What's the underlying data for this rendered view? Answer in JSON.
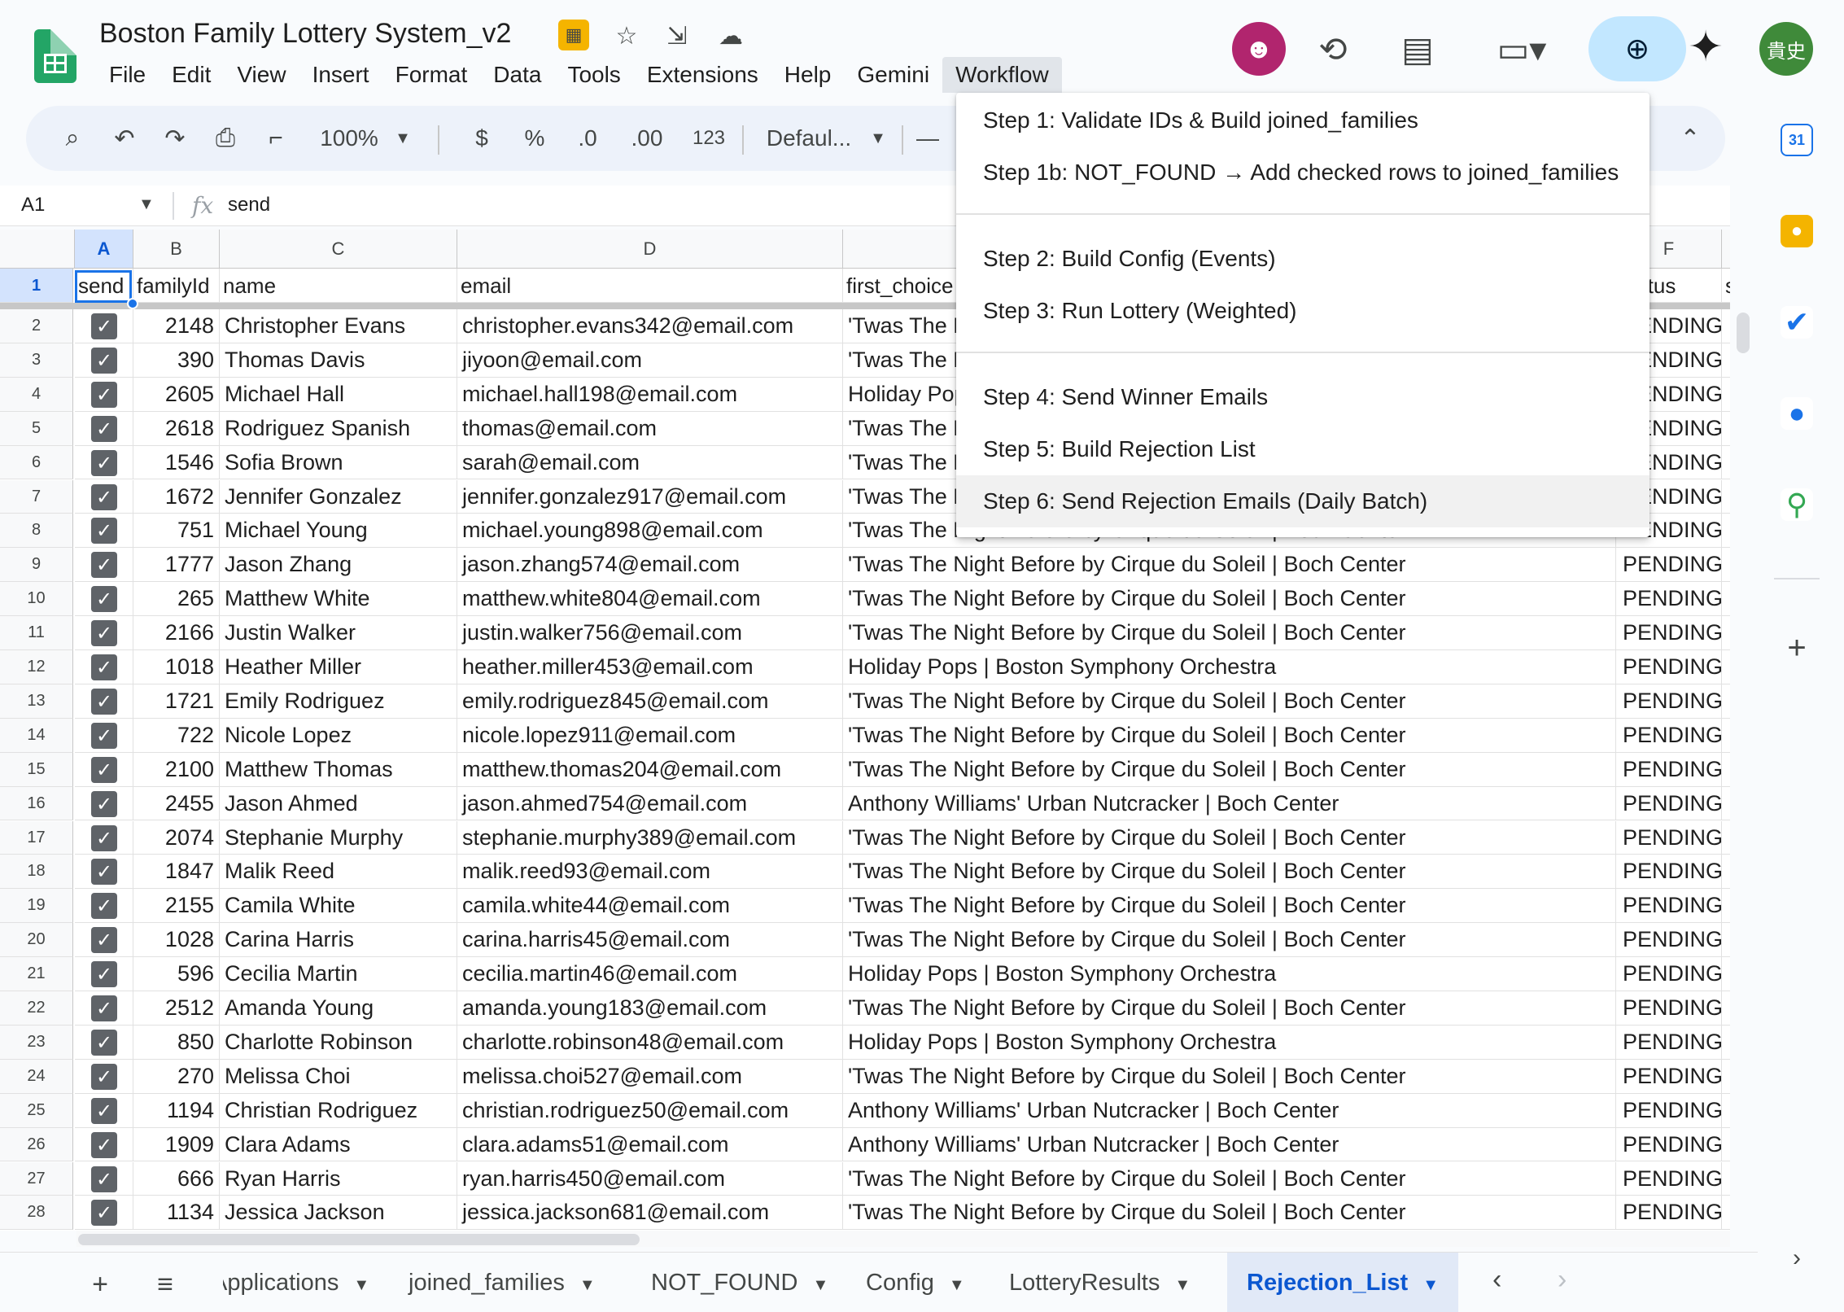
{
  "app": {
    "doc_title": "Boston Family Lottery System_v2",
    "menus": [
      "File",
      "Edit",
      "View",
      "Insert",
      "Format",
      "Data",
      "Tools",
      "Extensions",
      "Help",
      "Gemini",
      "Workflow"
    ],
    "active_menu": "Workflow",
    "user_initials": "貴史"
  },
  "toolbar": {
    "zoom": "100%",
    "currency": "$",
    "percent": "%",
    "decrease_decimals": ".0",
    "increase_decimals": ".00",
    "number_format": "123",
    "font": "Defaul...",
    "font_size_minus": "—"
  },
  "formula_bar": {
    "cell_ref": "A1",
    "fx": "fx",
    "value": "send"
  },
  "workflow_menu": {
    "groups": [
      [
        "Step 1: Validate IDs & Build joined_families",
        "Step 1b: NOT_FOUND → Add checked rows to joined_families"
      ],
      [
        "Step 2: Build Config (Events)",
        "Step 3: Run Lottery (Weighted)"
      ],
      [
        "Step 4: Send Winner Emails",
        "Step 5: Build Rejection List",
        "Step 6: Send Rejection Emails (Daily Batch)"
      ]
    ],
    "hovered": "Step 6: Send Rejection Emails (Daily Batch)"
  },
  "grid": {
    "column_letters": [
      "A",
      "B",
      "C",
      "D",
      "",
      "F",
      ""
    ],
    "header_row_number": "1",
    "headers": {
      "send": "send",
      "familyId": "familyId",
      "name": "name",
      "email": "email",
      "first_choice": "first_choice",
      "status": "status",
      "extra": "s"
    },
    "rows": [
      {
        "n": "2",
        "checked": true,
        "familyId": "2148",
        "name": "Christopher Evans",
        "email": "christopher.evans342@email.com",
        "first_choice": "'Twas The Night Before by Cirque du Soleil | Boch Center",
        "status": "PENDING"
      },
      {
        "n": "3",
        "checked": true,
        "familyId": "390",
        "name": "Thomas Davis",
        "email": "jiyoon@email.com",
        "first_choice": "'Twas The Night Before by Cirque du Soleil | Boch Center",
        "status": "PENDING"
      },
      {
        "n": "4",
        "checked": true,
        "familyId": "2605",
        "name": "Michael Hall",
        "email": "michael.hall198@email.com",
        "first_choice": "Holiday Pops | Boston Symphony Orchestra",
        "status": "PENDING"
      },
      {
        "n": "5",
        "checked": true,
        "familyId": "2618",
        "name": "Rodriguez Spanish",
        "email": "thomas@email.com",
        "first_choice": "'Twas The Night Before by Cirque du Soleil | Boch Center",
        "status": "PENDING"
      },
      {
        "n": "6",
        "checked": true,
        "familyId": "1546",
        "name": "Sofia Brown",
        "email": "sarah@email.com",
        "first_choice": "'Twas The Night Before by Cirque du Soleil | Boch Center",
        "status": "PENDING"
      },
      {
        "n": "7",
        "checked": true,
        "familyId": "1672",
        "name": "Jennifer Gonzalez",
        "email": "jennifer.gonzalez917@email.com",
        "first_choice": "'Twas The Night Before by Cirque du Soleil | Boch Center",
        "status": "PENDING"
      },
      {
        "n": "8",
        "checked": true,
        "familyId": "751",
        "name": "Michael Young",
        "email": "michael.young898@email.com",
        "first_choice": "'Twas The Night Before by Cirque du Soleil | Boch Center",
        "status": "PENDING"
      },
      {
        "n": "9",
        "checked": true,
        "familyId": "1777",
        "name": "Jason Zhang",
        "email": "jason.zhang574@email.com",
        "first_choice": "'Twas The Night Before by Cirque du Soleil | Boch Center",
        "status": "PENDING"
      },
      {
        "n": "10",
        "checked": true,
        "familyId": "265",
        "name": "Matthew White",
        "email": "matthew.white804@email.com",
        "first_choice": "'Twas The Night Before by Cirque du Soleil | Boch Center",
        "status": "PENDING"
      },
      {
        "n": "11",
        "checked": true,
        "familyId": "2166",
        "name": "Justin Walker",
        "email": "justin.walker756@email.com",
        "first_choice": "'Twas The Night Before by Cirque du Soleil | Boch Center",
        "status": "PENDING"
      },
      {
        "n": "12",
        "checked": true,
        "familyId": "1018",
        "name": "Heather Miller",
        "email": "heather.miller453@email.com",
        "first_choice": "Holiday Pops | Boston Symphony Orchestra",
        "status": "PENDING"
      },
      {
        "n": "13",
        "checked": true,
        "familyId": "1721",
        "name": "Emily Rodriguez",
        "email": "emily.rodriguez845@email.com",
        "first_choice": "'Twas The Night Before by Cirque du Soleil | Boch Center",
        "status": "PENDING"
      },
      {
        "n": "14",
        "checked": true,
        "familyId": "722",
        "name": "Nicole Lopez",
        "email": "nicole.lopez911@email.com",
        "first_choice": "'Twas The Night Before by Cirque du Soleil | Boch Center",
        "status": "PENDING"
      },
      {
        "n": "15",
        "checked": true,
        "familyId": "2100",
        "name": "Matthew Thomas",
        "email": "matthew.thomas204@email.com",
        "first_choice": "'Twas The Night Before by Cirque du Soleil | Boch Center",
        "status": "PENDING"
      },
      {
        "n": "16",
        "checked": true,
        "familyId": "2455",
        "name": "Jason Ahmed",
        "email": "jason.ahmed754@email.com",
        "first_choice": "Anthony Williams' Urban Nutcracker | Boch Center",
        "status": "PENDING"
      },
      {
        "n": "17",
        "checked": true,
        "familyId": "2074",
        "name": "Stephanie Murphy",
        "email": "stephanie.murphy389@email.com",
        "first_choice": "'Twas The Night Before by Cirque du Soleil | Boch Center",
        "status": "PENDING"
      },
      {
        "n": "18",
        "checked": true,
        "familyId": "1847",
        "name": "Malik Reed",
        "email": "malik.reed93@email.com",
        "first_choice": "'Twas The Night Before by Cirque du Soleil | Boch Center",
        "status": "PENDING"
      },
      {
        "n": "19",
        "checked": true,
        "familyId": "2155",
        "name": "Camila White",
        "email": "camila.white44@email.com",
        "first_choice": "'Twas The Night Before by Cirque du Soleil | Boch Center",
        "status": "PENDING"
      },
      {
        "n": "20",
        "checked": true,
        "familyId": "1028",
        "name": "Carina Harris",
        "email": "carina.harris45@email.com",
        "first_choice": "'Twas The Night Before by Cirque du Soleil | Boch Center",
        "status": "PENDING"
      },
      {
        "n": "21",
        "checked": true,
        "familyId": "596",
        "name": "Cecilia Martin",
        "email": "cecilia.martin46@email.com",
        "first_choice": "Holiday Pops | Boston Symphony Orchestra",
        "status": "PENDING"
      },
      {
        "n": "22",
        "checked": true,
        "familyId": "2512",
        "name": "Amanda Young",
        "email": "amanda.young183@email.com",
        "first_choice": "'Twas The Night Before by Cirque du Soleil | Boch Center",
        "status": "PENDING"
      },
      {
        "n": "23",
        "checked": true,
        "familyId": "850",
        "name": "Charlotte Robinson",
        "email": "charlotte.robinson48@email.com",
        "first_choice": "Holiday Pops | Boston Symphony Orchestra",
        "status": "PENDING"
      },
      {
        "n": "24",
        "checked": true,
        "familyId": "270",
        "name": "Melissa Choi",
        "email": "melissa.choi527@email.com",
        "first_choice": "'Twas The Night Before by Cirque du Soleil | Boch Center",
        "status": "PENDING"
      },
      {
        "n": "25",
        "checked": true,
        "familyId": "1194",
        "name": "Christian Rodriguez",
        "email": "christian.rodriguez50@email.com",
        "first_choice": "Anthony Williams' Urban Nutcracker | Boch Center",
        "status": "PENDING"
      },
      {
        "n": "26",
        "checked": true,
        "familyId": "1909",
        "name": "Clara Adams",
        "email": "clara.adams51@email.com",
        "first_choice": "Anthony Williams' Urban Nutcracker | Boch Center",
        "status": "PENDING"
      },
      {
        "n": "27",
        "checked": true,
        "familyId": "666",
        "name": "Ryan Harris",
        "email": "ryan.harris450@email.com",
        "first_choice": "'Twas The Night Before by Cirque du Soleil | Boch Center",
        "status": "PENDING"
      },
      {
        "n": "28",
        "checked": true,
        "familyId": "1134",
        "name": "Jessica Jackson",
        "email": "jessica.jackson681@email.com",
        "first_choice": "'Twas The Night Before by Cirque du Soleil | Boch Center",
        "status": "PENDING"
      }
    ]
  },
  "sheet_tabs": {
    "tabs": [
      "Applications",
      "joined_families",
      "NOT_FOUND",
      "Config",
      "LotteryResults",
      "Rejection_List"
    ],
    "active": "Rejection_List"
  },
  "side_panel": {
    "calendar_day": "31"
  },
  "icons": {
    "title": [
      "tools-badge-icon",
      "star-icon",
      "move-folder-icon",
      "cloud-saved-icon"
    ],
    "top_right": [
      "bot-avatar-icon",
      "history-icon",
      "comments-icon",
      "meet-icon",
      "share-icon",
      "gemini-icon"
    ]
  },
  "colors": {
    "sheets_green": "#23a566",
    "accent_blue": "#0b57d0",
    "share_blue": "#c2e7ff",
    "checkbox_gray": "#5f6368"
  }
}
